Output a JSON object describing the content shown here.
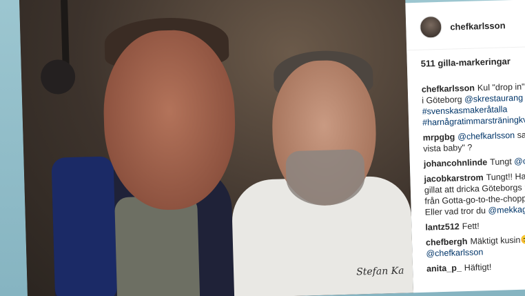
{
  "post": {
    "username": "chefkarlsson",
    "likes": "511 gilla-markeringar",
    "signature": "Stefan Ka"
  },
  "comments": [
    {
      "user": "chefkarlsson",
      "lines": [
        "Kul \"drop in\" gä",
        "i Göteborg @skrestaurang #a",
        "#svenskasmakeråtalla",
        "#harnågratimmarsträningkva"
      ]
    },
    {
      "user": "mrpgbg",
      "lines": [
        "@chefkarlsson sa ha",
        "vista baby\" ?"
      ]
    },
    {
      "user": "johancohnlinde",
      "lines": [
        "Tungt @chefk"
      ]
    },
    {
      "user": "jacobkarstrom",
      "lines": [
        "Tungt!! Han ha",
        "gillat att dricka Göteborgs mus",
        "från Gotta-go-to-the-chopper-l",
        "Eller vad tror du @mekkag? 😊"
      ]
    },
    {
      "user": "lantz512",
      "lines": [
        "Fett!"
      ]
    },
    {
      "user": "chefbergh",
      "lines": [
        "Mäktigt kusin😊",
        "@chefkarlsson"
      ]
    },
    {
      "user": "anita_p_",
      "lines": [
        "Häftigt!"
      ]
    }
  ]
}
